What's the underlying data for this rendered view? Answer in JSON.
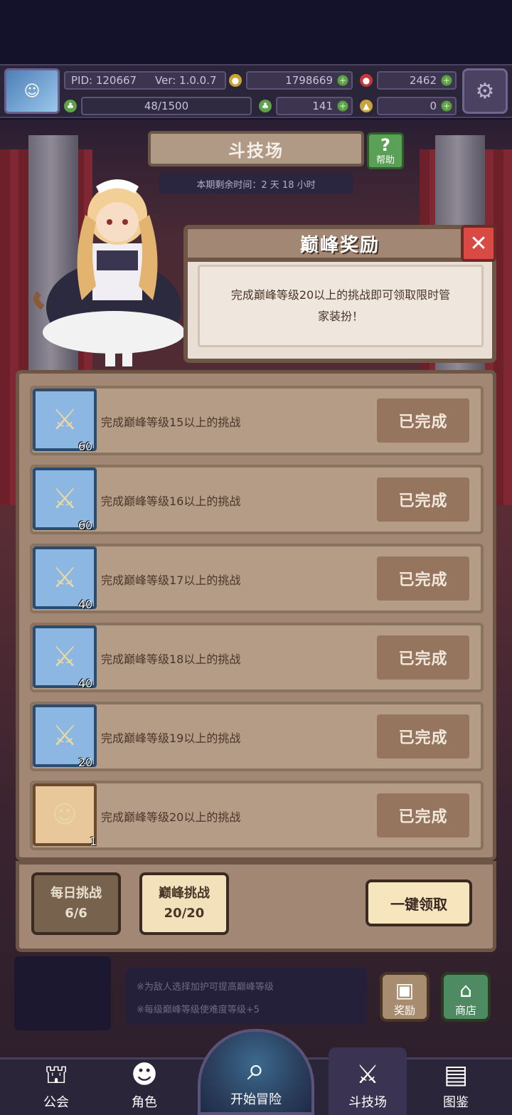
{
  "hud": {
    "pid": "PID: 120667",
    "version": "Ver: 1.0.0.7",
    "gold": "1798669",
    "gems": "2462",
    "stamina": "48/1500",
    "clover": "141",
    "token": "0"
  },
  "arena": {
    "title": "斗技场",
    "help_label": "帮助",
    "timer": "本期剩余时间：2 天 18 小时"
  },
  "popup": {
    "title": "巅峰奖励",
    "description": "完成巅峰等级20以上的挑战即可领取限时管家装扮！"
  },
  "rewards": [
    {
      "count": "60",
      "text": "完成巅峰等级15以上的挑战",
      "status": "已完成",
      "icon": "sword-shield-icon"
    },
    {
      "count": "60",
      "text": "完成巅峰等级16以上的挑战",
      "status": "已完成",
      "icon": "sword-shield-icon"
    },
    {
      "count": "40",
      "text": "完成巅峰等级17以上的挑战",
      "status": "已完成",
      "icon": "sword-shield-icon"
    },
    {
      "count": "40",
      "text": "完成巅峰等级18以上的挑战",
      "status": "已完成",
      "icon": "sword-shield-icon"
    },
    {
      "count": "20",
      "text": "完成巅峰等级19以上的挑战",
      "status": "已完成",
      "icon": "sword-shield-icon"
    },
    {
      "count": "1",
      "text": "完成巅峰等级20以上的挑战",
      "status": "已完成",
      "icon": "maid-portrait-icon"
    }
  ],
  "tabs": {
    "daily": {
      "label": "每日挑战",
      "value": "6/6"
    },
    "peak": {
      "label": "巅峰挑战",
      "value": "20/20"
    }
  },
  "claim_all": "一键领取",
  "notes": [
    "※为敌人选择加护可提高巅峰等级",
    "※每级巅峰等级使难度等级+5"
  ],
  "side_buttons": {
    "rewards": "奖励",
    "shop": "商店"
  },
  "nav": {
    "guild": "公会",
    "character": "角色",
    "start": "开始冒险",
    "arena": "斗技场",
    "codex": "图鉴"
  },
  "colors": {
    "panel": "#a28874",
    "panel_border": "#6e5646",
    "completed_button": "#96755f",
    "close_button": "#d94a45",
    "help_button": "#5aa056"
  }
}
